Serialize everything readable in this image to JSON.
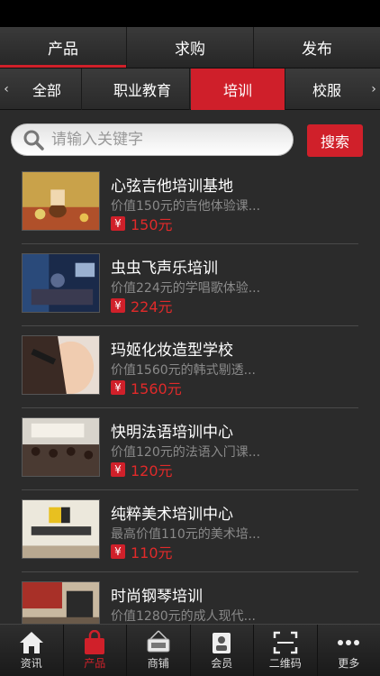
{
  "top_tabs": [
    {
      "label": "产品"
    },
    {
      "label": "求购"
    },
    {
      "label": "发布"
    }
  ],
  "top_tabs_active": 0,
  "categories": [
    {
      "label": "全部"
    },
    {
      "label": "职业教育"
    },
    {
      "label": "培训"
    },
    {
      "label": "校服"
    }
  ],
  "categories_active": 2,
  "category_nav": {
    "prev": "‹",
    "next": "›"
  },
  "search": {
    "placeholder": "请输入关键字",
    "value": "",
    "button_label": "搜索"
  },
  "products": [
    {
      "title": "心弦吉他培训基地",
      "desc": "价值150元的吉他体验课...",
      "currency": "¥",
      "price": "150元"
    },
    {
      "title": "虫虫飞声乐培训",
      "desc": "价值224元的学唱歌体验...",
      "currency": "¥",
      "price": "224元"
    },
    {
      "title": "玛姬化妆造型学校",
      "desc": "价值1560元的韩式剔透...",
      "currency": "¥",
      "price": "1560元"
    },
    {
      "title": "快明法语培训中心",
      "desc": "价值120元的法语入门课...",
      "currency": "¥",
      "price": "120元"
    },
    {
      "title": "纯粹美术培训中心",
      "desc": "最高价值110元的美术培...",
      "currency": "¥",
      "price": "110元"
    },
    {
      "title": "时尚钢琴培训",
      "desc": "价值1280元的成人现代...",
      "currency": "¥",
      "price": ""
    }
  ],
  "bottom_nav": [
    {
      "label": "资讯",
      "icon": "home-icon"
    },
    {
      "label": "产品",
      "icon": "shopping-bag-icon"
    },
    {
      "label": "商铺",
      "icon": "shop-open-sign-icon"
    },
    {
      "label": "会员",
      "icon": "member-card-icon"
    },
    {
      "label": "二维码",
      "icon": "qr-scan-icon"
    },
    {
      "label": "更多",
      "icon": "more-dots-icon"
    }
  ],
  "bottom_nav_active": 1,
  "colors": {
    "accent": "#d0202a",
    "background": "#2b2b2b",
    "price": "#e02a2a"
  }
}
